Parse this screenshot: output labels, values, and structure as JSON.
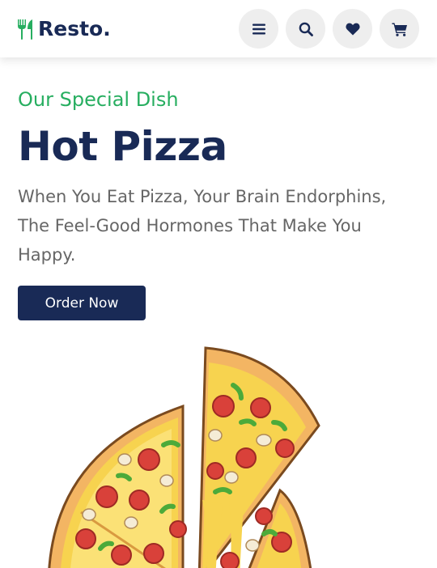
{
  "header": {
    "logo_text": "Resto.",
    "logo_icon": "fork-knife-icon",
    "icons": [
      "menu-icon",
      "search-icon",
      "heart-icon",
      "cart-icon"
    ]
  },
  "home": {
    "subtitle": "Our Special Dish",
    "title": "Hot Pizza",
    "description": "When You Eat Pizza, Your Brain Endorphins, The Feel-Good Hormones That Make You Happy.",
    "button_label": "Order Now"
  },
  "colors": {
    "accent": "#27ae60",
    "primary": "#192a56",
    "text_muted": "#666666",
    "icon_bg": "#eeeeee"
  }
}
